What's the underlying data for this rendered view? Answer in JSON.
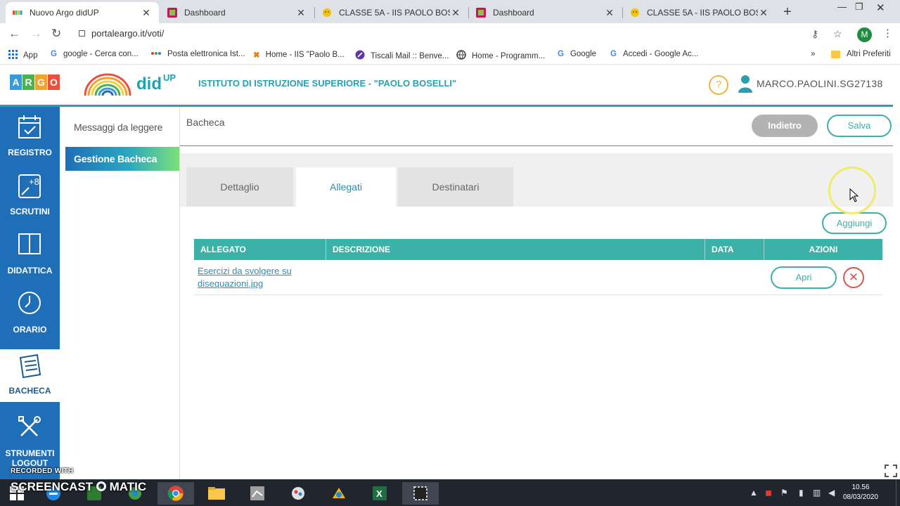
{
  "browser": {
    "tabs": [
      {
        "title": "Nuovo Argo didUP",
        "active": true
      },
      {
        "title": "Dashboard",
        "active": false
      },
      {
        "title": "CLASSE 5A - IIS PAOLO BOSELLI",
        "active": false
      },
      {
        "title": "Dashboard",
        "active": false
      },
      {
        "title": "CLASSE 5A - IIS PAOLO BOSELLI",
        "active": false
      }
    ],
    "url": "portaleargo.it/voti/",
    "profile_initial": "M",
    "bookmarks": [
      {
        "label": "App",
        "icon": "apps-grid-icon"
      },
      {
        "label": "google - Cerca con...",
        "icon": "google-icon"
      },
      {
        "label": "Posta elettronica Ist...",
        "icon": "mail-icon"
      },
      {
        "label": "Home - IIS \"Paolo B...",
        "icon": "joomla-icon"
      },
      {
        "label": "Tiscali Mail :: Benve...",
        "icon": "tiscali-icon"
      },
      {
        "label": "Home - Programm...",
        "icon": "globe-icon"
      },
      {
        "label": "Google",
        "icon": "google-icon"
      },
      {
        "label": "Accedi - Google Ac...",
        "icon": "google-icon"
      }
    ],
    "other_bookmarks": "Altri Preferiti"
  },
  "header": {
    "argo_letters": [
      "A",
      "R",
      "G",
      "O"
    ],
    "product": "did",
    "product_sup": "UP",
    "school": "ISTITUTO DI ISTRUZIONE SUPERIORE - \"PAOLO BOSELLI\"",
    "help": "?",
    "user": "MARCO.PAOLINI.SG27138"
  },
  "sidenav": {
    "items": [
      {
        "label": "REGISTRO",
        "icon": "calendar-check-icon",
        "active": false
      },
      {
        "label": "SCRUTINI",
        "icon": "grades-icon",
        "active": false
      },
      {
        "label": "DIDATTICA",
        "icon": "book-icon",
        "active": false
      },
      {
        "label": "ORARIO",
        "icon": "clock-icon",
        "active": false
      },
      {
        "label": "BACHECA",
        "icon": "bulletin-board-icon",
        "active": true
      },
      {
        "label": "STRUMENTI",
        "icon": "tools-icon",
        "active": false
      }
    ],
    "logout": "LOGOUT"
  },
  "subnav": {
    "items": [
      {
        "label": "Messaggi da leggere",
        "active": false
      },
      {
        "label": "Gestione Bacheca",
        "active": true
      }
    ]
  },
  "main": {
    "title": "Bacheca",
    "back_label": "Indietro",
    "save_label": "Salva",
    "tabs": [
      {
        "label": "Dettaglio",
        "active": false
      },
      {
        "label": "Allegati",
        "active": true
      },
      {
        "label": "Destinatari",
        "active": false
      }
    ],
    "add_label": "Aggiungi",
    "table": {
      "columns": [
        "ALLEGATO",
        "DESCRIZIONE",
        "DATA",
        "AZIONI"
      ],
      "rows": [
        {
          "allegato": "Esercizi da svolgere su disequazioni.jpg",
          "descrizione": "",
          "data": "",
          "open_label": "Apri",
          "delete_symbol": "✕"
        }
      ]
    }
  },
  "overlay": {
    "recorded_with": "RECORDED WITH",
    "screencast": "SCREENCAST",
    "matic": "MATIC"
  },
  "taskbar": {
    "time": "10.56",
    "date": "08/03/2020"
  },
  "colors": {
    "nav_blue": "#1e6fb8",
    "teal": "#3bb1a8",
    "accent": "#2a9fb3",
    "delete_red": "#d9534f"
  }
}
